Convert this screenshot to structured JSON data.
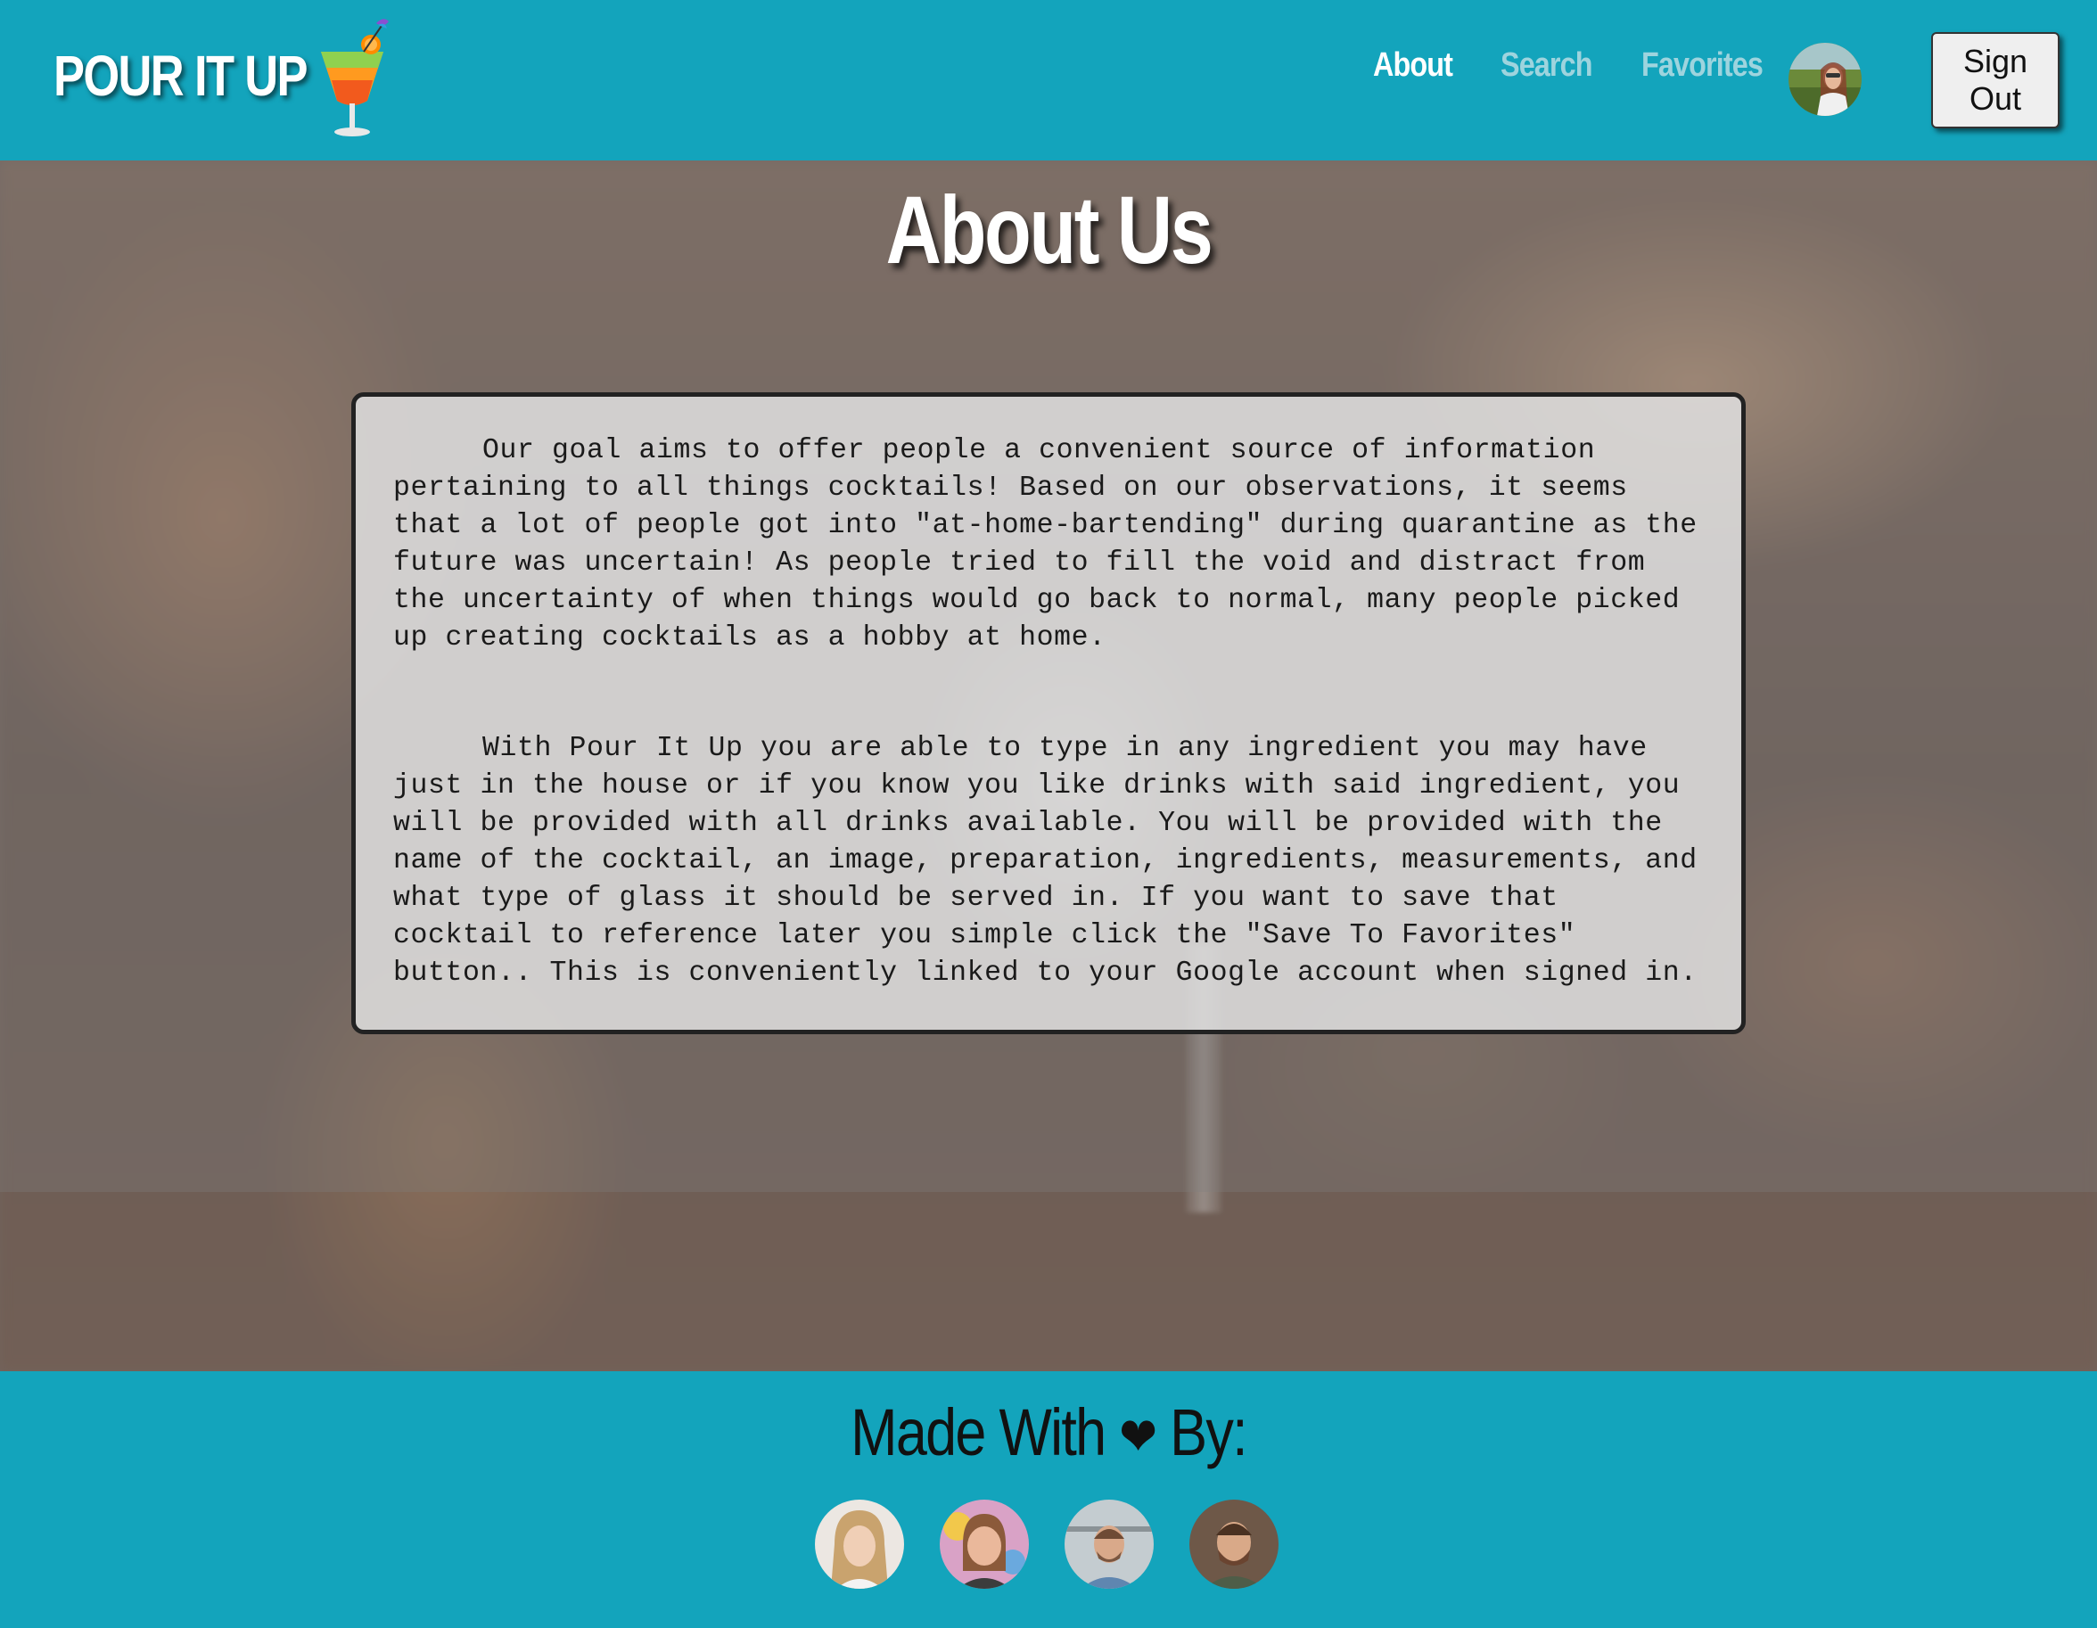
{
  "app": {
    "title": "POUR IT UP"
  },
  "nav": {
    "items": [
      {
        "label": "About",
        "active": true
      },
      {
        "label": "Search",
        "active": false
      },
      {
        "label": "Favorites",
        "active": false
      }
    ],
    "signout_label": "Sign Out"
  },
  "page": {
    "title": "About Us",
    "paragraphs": [
      "Our goal aims to offer people a convenient source of information pertaining to all things cocktails! Based on our observations, it seems that a lot of people got into \"at-home-bartending\" during quarantine as the future was uncertain! As people tried to fill the void and distract from the uncertainty of when things would go back to normal, many people picked up creating cocktails as a hobby at home.",
      "With Pour It Up you are able to type in any ingredient you may have just in the house or if you know you like drinks with said ingredient, you will be provided with all drinks available. You will be provided with the name of the cocktail, an image, preparation, ingredients, measurements, and what type of glass it should be served in. If you want to save that cocktail to reference later you simple click the \"Save To Favorites\" button.. This is conveniently linked to your Google account when signed in."
    ]
  },
  "footer": {
    "title_prefix": "Made With",
    "heart": "❤",
    "title_suffix": "By:"
  },
  "colors": {
    "brand": "#13a4bc",
    "nav_active": "#ffffff",
    "nav_inactive": "#9ed4de"
  }
}
